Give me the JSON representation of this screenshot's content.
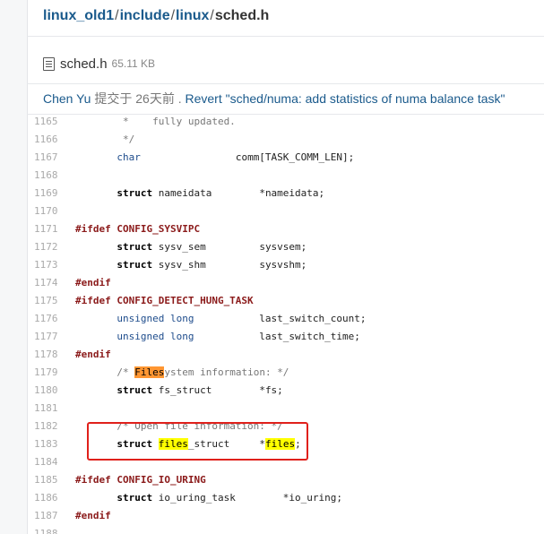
{
  "breadcrumb": [
    "linux_old1",
    "include",
    "linux",
    "sched.h"
  ],
  "file": {
    "name": "sched.h",
    "size": "65.11 KB"
  },
  "commit": {
    "author": "Chen Yu",
    "action": "提交于",
    "time": "26天前",
    "separator": ".",
    "message": "Revert \"sched/numa: add statistics of numa balance task\""
  },
  "icons": {
    "file": "file-icon"
  },
  "colors": {
    "link": "#1a5a8c",
    "highlight_current": "#ff9632",
    "highlight_match": "#ffff00",
    "callout": "#e0201b"
  },
  "code_lines": [
    {
      "n": "1165",
      "tokens": [
        {
          "t": "        *    fully updated.",
          "c": "cm"
        }
      ]
    },
    {
      "n": "1166",
      "tokens": [
        {
          "t": "        */",
          "c": "cm"
        }
      ]
    },
    {
      "n": "1167",
      "tokens": [
        {
          "t": "       "
        },
        {
          "t": "char",
          "c": "ty"
        },
        {
          "t": "                comm[TASK_COMM_LEN];"
        }
      ]
    },
    {
      "n": "1168",
      "tokens": []
    },
    {
      "n": "1169",
      "tokens": [
        {
          "t": "       "
        },
        {
          "t": "struct",
          "c": "kw"
        },
        {
          "t": " nameidata        *nameidata;"
        }
      ]
    },
    {
      "n": "1170",
      "tokens": []
    },
    {
      "n": "1171",
      "tokens": [
        {
          "t": "#ifdef CONFIG_SYSVIPC",
          "c": "pp"
        }
      ]
    },
    {
      "n": "1172",
      "tokens": [
        {
          "t": "       "
        },
        {
          "t": "struct",
          "c": "kw"
        },
        {
          "t": " sysv_sem         sysvsem;"
        }
      ]
    },
    {
      "n": "1173",
      "tokens": [
        {
          "t": "       "
        },
        {
          "t": "struct",
          "c": "kw"
        },
        {
          "t": " sysv_shm         sysvshm;"
        }
      ]
    },
    {
      "n": "1174",
      "tokens": [
        {
          "t": "#endif",
          "c": "pp"
        }
      ]
    },
    {
      "n": "1175",
      "tokens": [
        {
          "t": "#ifdef CONFIG_DETECT_HUNG_TASK",
          "c": "pp"
        }
      ]
    },
    {
      "n": "1176",
      "tokens": [
        {
          "t": "       "
        },
        {
          "t": "unsigned long",
          "c": "ty"
        },
        {
          "t": "           last_switch_count;"
        }
      ]
    },
    {
      "n": "1177",
      "tokens": [
        {
          "t": "       "
        },
        {
          "t": "unsigned long",
          "c": "ty"
        },
        {
          "t": "           last_switch_time;"
        }
      ]
    },
    {
      "n": "1178",
      "tokens": [
        {
          "t": "#endif",
          "c": "pp"
        }
      ]
    },
    {
      "n": "1179",
      "tokens": [
        {
          "t": "       "
        },
        {
          "t": "/* ",
          "c": "cm"
        },
        {
          "t": "Files",
          "c": "hl-o"
        },
        {
          "t": "ystem information: */",
          "c": "cm"
        }
      ]
    },
    {
      "n": "1180",
      "tokens": [
        {
          "t": "       "
        },
        {
          "t": "struct",
          "c": "kw"
        },
        {
          "t": " fs_struct        *fs;"
        }
      ]
    },
    {
      "n": "1181",
      "tokens": []
    },
    {
      "n": "1182",
      "tokens": [
        {
          "t": "       "
        },
        {
          "t": "/* Open file information: */",
          "c": "cm"
        }
      ]
    },
    {
      "n": "1183",
      "tokens": [
        {
          "t": "       "
        },
        {
          "t": "struct",
          "c": "kw"
        },
        {
          "t": " "
        },
        {
          "t": "files",
          "c": "hl-y"
        },
        {
          "t": "_struct     *"
        },
        {
          "t": "files",
          "c": "hl-y"
        },
        {
          "t": ";"
        }
      ]
    },
    {
      "n": "1184",
      "tokens": []
    },
    {
      "n": "1185",
      "tokens": [
        {
          "t": "#ifdef CONFIG_IO_URING",
          "c": "pp"
        }
      ]
    },
    {
      "n": "1186",
      "tokens": [
        {
          "t": "       "
        },
        {
          "t": "struct",
          "c": "kw"
        },
        {
          "t": " io_uring_task        *io_uring;"
        }
      ]
    },
    {
      "n": "1187",
      "tokens": [
        {
          "t": "#endif",
          "c": "pp"
        }
      ]
    },
    {
      "n": "1188",
      "tokens": []
    }
  ]
}
